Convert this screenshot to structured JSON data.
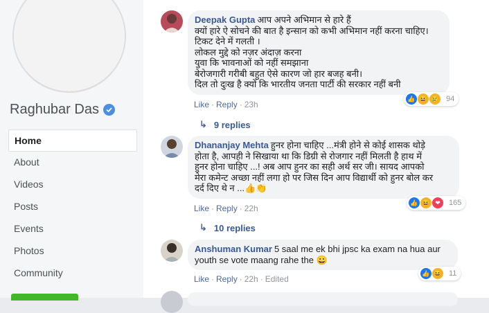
{
  "sidebar": {
    "page_name": "Raghubar Das",
    "nav": [
      {
        "label": "Home",
        "active": true
      },
      {
        "label": "About"
      },
      {
        "label": "Videos"
      },
      {
        "label": "Posts"
      },
      {
        "label": "Events"
      },
      {
        "label": "Photos"
      },
      {
        "label": "Community"
      }
    ]
  },
  "comments": [
    {
      "author": "Deepak Gupta",
      "lines": [
        "आप अपने अभिमान से हारे हैं",
        "क्यों हारे ऐ सोचने की बात है इन्सान को कभी अभिमान नहीं करना चाहिए।",
        "टिकट देने में गलती ।",
        "लोकल मुद्दे को नज़र अंदाज़ करना",
        "युवा कि भावनाओं को नहीं समझाना",
        "बेरोजगारी गरीबी बहुत ऐसे कारण जो हार बजह बनी।",
        "दिल तो दुःख है क्यों कि भारतीय जनता पार्टी की सरकार नहीं बनी"
      ],
      "like": "Like",
      "reply": "Reply",
      "time": "23h",
      "reaction_count": "94",
      "replies_label": "9 replies"
    },
    {
      "author": "Dhananjay Mehta",
      "lines": [
        "हुनर होना चाहिए ...मंत्री होने से कोई शासक थोड़े",
        "होता है, आपही ने सिखाया था कि डिग्री से रोजगार नहीं मिलती है हाथ में",
        "हुनर होना चाहिए ...! अब आप हुनर का सही अर्थ सर जी। सायद आपको",
        "मेरा कमेन्ट अच्छा नहीं लगा हो पर जिस दिन आप विद्यार्थी को हुनर बोल कर",
        "दर्द दिए थे न ...👍👏"
      ],
      "like": "Like",
      "reply": "Reply",
      "time": "22h",
      "reaction_count": "165",
      "replies_label": "10 replies"
    },
    {
      "author": "Anshuman Kumar",
      "lines": [
        "5 saal me ek bhi jpsc ka exam na hua aur",
        "youth se vote maang rahe the 😀"
      ],
      "like": "Like",
      "reply": "Reply",
      "time": "22h",
      "edited": "Edited",
      "reaction_count": "11"
    }
  ],
  "colors": {
    "link": "#385898",
    "bubble": "#f2f3f5",
    "sidebar_bg": "#f5f6f7",
    "like_blue": "#1877f2",
    "haha_yellow": "#f7b125",
    "love_red": "#f33e58"
  }
}
